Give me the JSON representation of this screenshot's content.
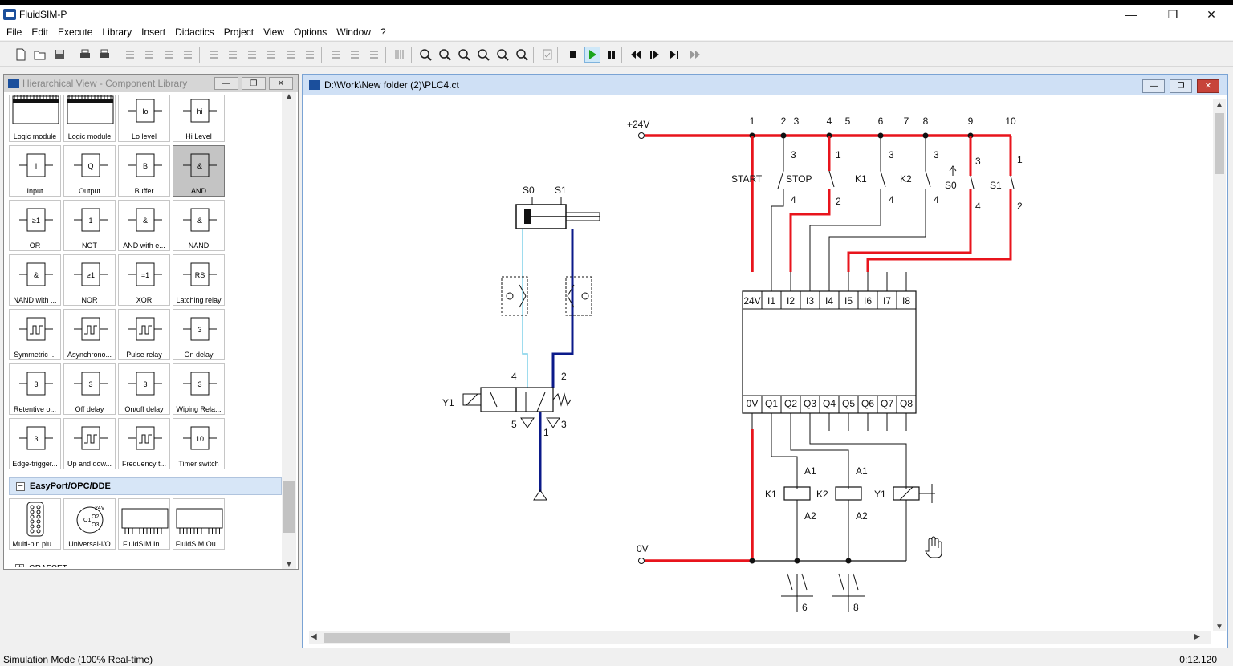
{
  "app": {
    "title": "FluidSIM-P"
  },
  "menu": [
    "File",
    "Edit",
    "Execute",
    "Library",
    "Insert",
    "Didactics",
    "Project",
    "View",
    "Options",
    "Window",
    "?"
  ],
  "toolbar": {
    "icons": [
      "new-icon",
      "open-icon",
      "save-icon",
      "print-preview-icon",
      "print-icon",
      "undo-icon",
      "cut-icon",
      "copy-icon",
      "paste-icon",
      "align-left-icon",
      "align-center-icon",
      "align-right-icon",
      "align-top-icon",
      "align-middle-icon",
      "align-bottom-icon",
      "rotate-icon",
      "mirror-h-icon",
      "mirror-v-icon",
      "grid-icon",
      "zoom-fit-icon",
      "zoom-window-icon",
      "zoom-previous-icon",
      "zoom-all-icon",
      "zoom-in-icon",
      "zoom-out-icon",
      "check-icon",
      "stop-icon",
      "play-icon",
      "pause-icon",
      "rewind-icon",
      "step-icon",
      "step-end-icon",
      "fast-forward-icon"
    ],
    "active": "play-icon",
    "accent": "#1aa51a"
  },
  "library": {
    "title": "Hierarchical View - Component Library",
    "tiles": [
      "Logic module",
      "Logic module",
      "Lo level",
      "Hi Level",
      "Input",
      "Output",
      "Buffer",
      "AND",
      "OR",
      "NOT",
      "AND with e...",
      "NAND",
      "NAND with ...",
      "NOR",
      "XOR",
      "Latching relay",
      "Symmetric ...",
      "Asynchrono...",
      "Pulse relay",
      "On delay",
      "Retentive o...",
      "Off delay",
      "On/off delay",
      "Wiping Rela...",
      "Edge-trigger...",
      "Up and dow...",
      "Frequency t...",
      "Timer switch"
    ],
    "tile_glyphs": {
      "lo": "lo",
      "hi": "hi",
      "input": "I",
      "output": "Q",
      "buffer": "B",
      "and": "&",
      "or": "≥1",
      "not": "1",
      "and_edge": "&",
      "nand": "&",
      "nand_edge": "&",
      "nor": "≥1",
      "xor": "=1",
      "latch": "RS",
      "timer_3": "3",
      "timer_10": "10"
    },
    "selected": "AND",
    "group_easyport": "EasyPort/OPC/DDE",
    "easyport_tiles": [
      "Multi-pin plu...",
      "Universal-I/O",
      "FluidSIM In...",
      "FluidSIM Ou..."
    ],
    "universal_io_glyphs": [
      "24V",
      "O1",
      "O2",
      "O3"
    ],
    "group_grafcet": "GRAFCET"
  },
  "diagram": {
    "title": "D:\\Work\\New folder (2)\\PLC4.ct",
    "supply_plus": "+24V",
    "supply_zero": "0V",
    "column_numbers": [
      "1",
      "2",
      "3",
      "4",
      "5",
      "6",
      "7",
      "8",
      "9",
      "10"
    ],
    "contact_labels": [
      "START",
      "STOP",
      "K1",
      "K2",
      "S0",
      "S1"
    ],
    "terminal_numbers": {
      "t3": "3",
      "t4": "4",
      "t1": "1",
      "t2": "2"
    },
    "plc_inputs": [
      "24V",
      "I1",
      "I2",
      "I3",
      "I4",
      "I5",
      "I6",
      "I7",
      "I8"
    ],
    "plc_outputs": [
      "0V",
      "Q1",
      "Q2",
      "Q3",
      "Q4",
      "Q5",
      "Q6",
      "Q7",
      "Q8"
    ],
    "coils": [
      "K1",
      "K2",
      "Y1"
    ],
    "coil_terminals": [
      "A1",
      "A2"
    ],
    "relay_contact_refs": [
      "6",
      "8"
    ],
    "cylinder_sensors": [
      "S0",
      "S1"
    ],
    "valve": {
      "solenoid": "Y1",
      "ports": [
        "4",
        "2",
        "5",
        "1",
        "3"
      ]
    },
    "colors": {
      "energized": "#e8141c",
      "pressure": "#0b1a8a",
      "exhaust": "#7fd0e8",
      "wire": "#111111"
    }
  },
  "status": {
    "mode": "Simulation Mode (100% Real-time)",
    "time": "0:12.120"
  }
}
